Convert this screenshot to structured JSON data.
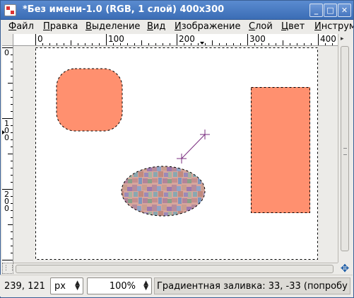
{
  "window": {
    "title": "*Без имени-1.0 (RGB, 1 слой) 400x300",
    "buttons": [
      "_",
      "□",
      "✕"
    ]
  },
  "menubar": {
    "items": [
      {
        "label": "Файл",
        "accel": "Ф",
        "rest": "айл"
      },
      {
        "label": "Правка",
        "accel": "П",
        "rest": "равка"
      },
      {
        "label": "Выделение",
        "accel": "В",
        "rest": "ыделение"
      },
      {
        "label": "Вид",
        "accel": "В",
        "rest": "ид"
      },
      {
        "label": "Изображение",
        "accel": "И",
        "rest": "зображение"
      },
      {
        "label": "Слой",
        "accel": "С",
        "rest": "лой"
      },
      {
        "label": "Цвет",
        "accel": "Ц",
        "rest": "вет"
      },
      {
        "label": "Инструм",
        "accel": "И",
        "rest": "нструм"
      }
    ]
  },
  "rulers": {
    "horizontal_labels": [
      "0",
      "100",
      "200",
      "300",
      "400"
    ],
    "vertical_labels": [
      "0",
      "100",
      "200"
    ]
  },
  "canvas": {
    "fill_color": "#ff906f",
    "selection_color": "#000000",
    "gradient_line_color": "#7a2e7f"
  },
  "statusbar": {
    "coords": "239, 121",
    "unit": "px",
    "zoom": "100%",
    "message": "Градиентная заливка: 33, -33 (попробу"
  },
  "icons": {
    "quickmask": "quick-mask-icon",
    "navigate": "navigate-icon"
  }
}
